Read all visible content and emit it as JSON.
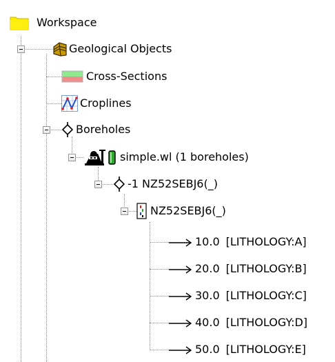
{
  "tree": {
    "workspace": {
      "label": "Workspace",
      "icon": "folder-icon"
    },
    "geological_objects": {
      "label": "Geological Objects",
      "icon": "geological-layers-icon"
    },
    "cross_sections": {
      "label": "Cross-Sections",
      "icon": "cross-section-icon"
    },
    "croplines": {
      "label": "Croplines",
      "icon": "cropline-icon"
    },
    "boreholes": {
      "label": "Boreholes",
      "icon": "borehole-diamond-icon"
    },
    "well_file": {
      "label": "simple.wl (1 boreholes)",
      "icons": [
        "drill-rig-icon",
        "green-cylinder-icon"
      ]
    },
    "borehole": {
      "label": "-1 NZ52SEBJ6(_)",
      "icon": "borehole-diamond-icon"
    },
    "log": {
      "label": "NZ52SEBJ6(_)",
      "icon": "log-track-icon"
    },
    "intervals": [
      {
        "depth": "10.0",
        "unit": "[LITHOLOGY:A]"
      },
      {
        "depth": "20.0",
        "unit": "[LITHOLOGY:B]"
      },
      {
        "depth": "30.0",
        "unit": "[LITHOLOGY:C]"
      },
      {
        "depth": "40.0",
        "unit": "[LITHOLOGY:D]"
      },
      {
        "depth": "50.0",
        "unit": "[LITHOLOGY:E]"
      }
    ]
  },
  "colors": {
    "folder": "#ffeb00",
    "layers": "#c89a00",
    "section_green": "#90e890",
    "section_red": "#f08e8e",
    "cylinder_green": "#2ea82e",
    "dots": "#8a8a8a"
  }
}
